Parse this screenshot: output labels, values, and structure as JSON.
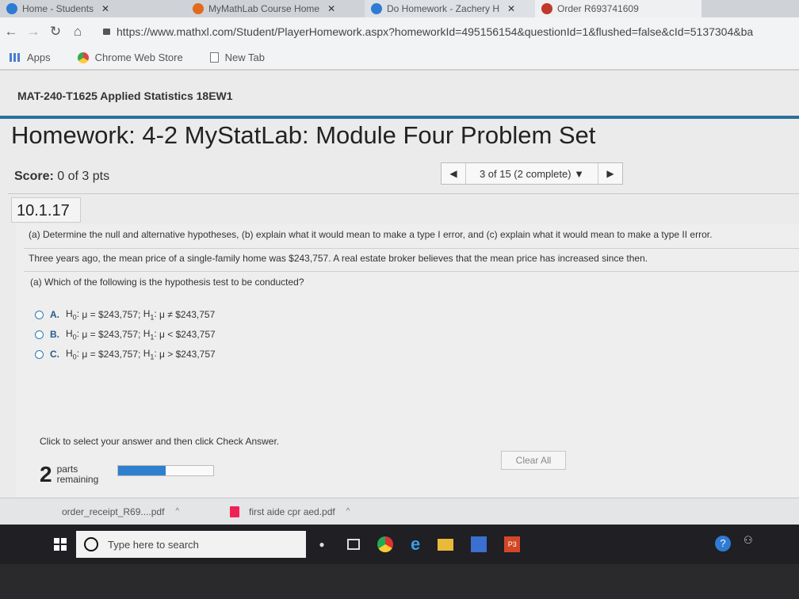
{
  "browser": {
    "tabs": [
      {
        "label": "Home - Students",
        "color": "#2e7bd4"
      },
      {
        "label": "MyMathLab Course Home",
        "color": "#e06b1f"
      },
      {
        "label": "Do Homework - Zachery H",
        "color": "#2e7bd4"
      },
      {
        "label": "Order R693741609",
        "color": "#c0392b"
      }
    ],
    "url": "https://www.mathxl.com/Student/PlayerHomework.aspx?homeworkId=495156154&questionId=1&flushed=false&cId=5137304&ba",
    "bookmarks": [
      "Apps",
      "Chrome Web Store",
      "New Tab"
    ]
  },
  "course": {
    "title": "MAT-240-T1625 Applied Statistics 18EW1"
  },
  "homework": {
    "title": "Homework: 4-2 MyStatLab: Module Four Problem Set",
    "score_label": "Score:",
    "score_value": "0 of 3 pts",
    "pager_text": "3 of 15 (2 complete) ▼"
  },
  "question": {
    "number": "10.1.17",
    "intro": "(a) Determine the null and alternative hypotheses, (b) explain what it would mean to make a type I error, and (c) explain what it would mean to make a type II error.",
    "stem": "Three years ago, the mean price of a single-family home was $243,757. A real estate broker believes that the mean price has increased since then.",
    "subq": "(a) Which of the following is the hypothesis test to be conducted?",
    "options": [
      {
        "label": "A.",
        "h0": "μ = $243,757;",
        "h1": "μ ≠ $243,757"
      },
      {
        "label": "B.",
        "h0": "μ = $243,757;",
        "h1": "μ < $243,757"
      },
      {
        "label": "C.",
        "h0": "μ = $243,757;",
        "h1": "μ > $243,757"
      }
    ],
    "instruction": "Click to select your answer and then click Check Answer.",
    "clear_all": "Clear All",
    "parts_count": "2",
    "parts_label1": "parts",
    "parts_label2": "remaining",
    "progress_fraction": 0.5
  },
  "downloads": [
    "order_receipt_R69....pdf",
    "first aide cpr aed.pdf"
  ],
  "taskbar": {
    "search_placeholder": "Type here to search",
    "ppt_label": "P3",
    "help_label": "?"
  }
}
